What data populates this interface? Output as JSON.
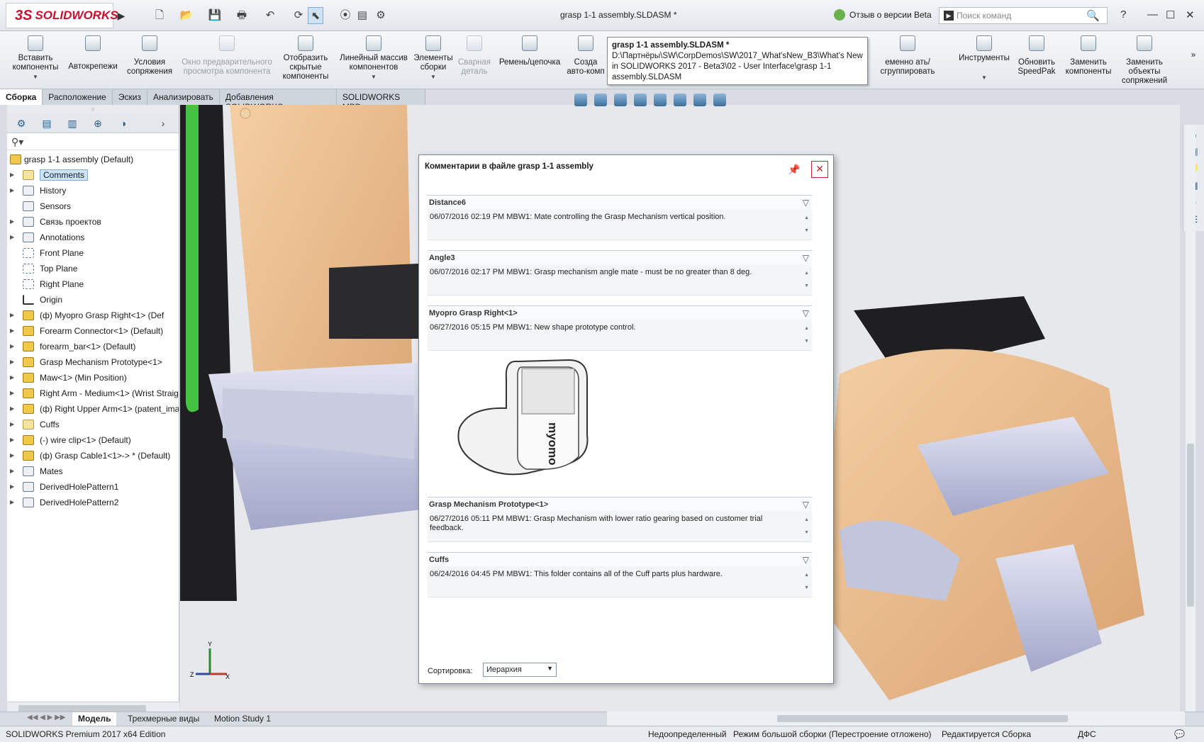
{
  "app": {
    "logo": "SOLIDWORKS",
    "window_title": "grasp 1-1 assembly.SLDASM *",
    "beta_feedback": "Отзыв о версии Beta",
    "search_placeholder": "Поиск команд",
    "help": "?"
  },
  "ribbon": {
    "buttons": [
      {
        "label": "Вставить компоненты",
        "enabled": true
      },
      {
        "label": "Автокрепежи",
        "enabled": true
      },
      {
        "label": "Условия сопряжения",
        "enabled": true
      },
      {
        "label": "Окно предварительного просмотра компонента",
        "enabled": false
      },
      {
        "label": "Отобразить скрытые компоненты",
        "enabled": true
      },
      {
        "label": "Линейный массив компонентов",
        "enabled": true
      },
      {
        "label": "Элементы сборки",
        "enabled": true
      },
      {
        "label": "Сварная деталь",
        "enabled": false
      },
      {
        "label": "Ремень/цепочка",
        "enabled": true
      },
      {
        "label": "Созда авто-комп",
        "enabled": true
      },
      {
        "label": "еменно ать/сгруппировать",
        "enabled": true
      },
      {
        "label": "Инструменты",
        "enabled": true
      },
      {
        "label": "Обновить SpeedPak",
        "enabled": true
      },
      {
        "label": "Заменить компоненты",
        "enabled": true
      },
      {
        "label": "Заменить объекты сопряжений",
        "enabled": true
      }
    ]
  },
  "tooltip": {
    "title": "grasp 1-1 assembly.SLDASM *",
    "path": "D:\\Партнёры\\SW\\CorpDemos\\SW\\2017_What'sNew_B3\\What's New in SOLIDWORKS 2017 - Beta3\\02 - User Interface\\grasp 1-1 assembly.SLDASM"
  },
  "command_tabs": [
    "Сборка",
    "Расположение",
    "Эскиз",
    "Анализировать",
    "Добавления SOLIDWORKS",
    "SOLIDWORKS MBD"
  ],
  "tree": {
    "root": "grasp 1-1 assembly  (Default)",
    "items": [
      {
        "label": "Comments",
        "selected": true,
        "icon": "folder"
      },
      {
        "label": "History",
        "icon": "history"
      },
      {
        "label": "Sensors",
        "icon": "sensor"
      },
      {
        "label": "Связь проектов",
        "icon": "link"
      },
      {
        "label": "Annotations",
        "icon": "annotation"
      },
      {
        "label": "Front Plane",
        "icon": "plane"
      },
      {
        "label": "Top Plane",
        "icon": "plane"
      },
      {
        "label": "Right Plane",
        "icon": "plane"
      },
      {
        "label": "Origin",
        "icon": "origin"
      },
      {
        "label": "(ф) Myopro Grasp Right<1> (Def",
        "icon": "assembly"
      },
      {
        "label": "Forearm Connector<1> (Default)",
        "icon": "assembly"
      },
      {
        "label": "forearm_bar<1> (Default)",
        "icon": "assembly"
      },
      {
        "label": "Grasp Mechanism Prototype<1>",
        "icon": "assembly"
      },
      {
        "label": "Maw<1> (Min Position)",
        "icon": "assembly"
      },
      {
        "label": "Right Arm - Medium<1> (Wrist Straig",
        "icon": "assembly"
      },
      {
        "label": "(ф) Right Upper Arm<1> (patent_ima",
        "icon": "assembly"
      },
      {
        "label": "Cuffs",
        "icon": "folder"
      },
      {
        "label": "(-) wire clip<1> (Default)",
        "icon": "assembly"
      },
      {
        "label": "(ф) Grasp Cable1<1>-> * (Default)",
        "icon": "assembly"
      },
      {
        "label": "Mates",
        "icon": "mates"
      },
      {
        "label": "DerivedHolePattern1",
        "icon": "pattern"
      },
      {
        "label": "DerivedHolePattern2",
        "icon": "pattern"
      }
    ]
  },
  "dialog": {
    "title": "Комментарии в файле grasp 1-1 assembly",
    "comments": [
      {
        "name": "Distance6",
        "text": "06/07/2016 02:19 PM  MBW1:  Mate controlling the Grasp Mechanism vertical position."
      },
      {
        "name": "Angle3",
        "text": "06/07/2016 02:17 PM  MBW1:  Grasp mechanism angle mate - must be no greater than 8 deg."
      },
      {
        "name": "Myopro Grasp Right<1>",
        "text": "06/27/2016 05:15 PM  MBW1:  New shape prototype control."
      },
      {
        "name": "Grasp Mechanism Prototype<1>",
        "text": "06/27/2016 05:11 PM  MBW1: Grasp Mechanism with lower ratio gearing based on customer trial feedback."
      },
      {
        "name": "Cuffs",
        "text": "06/24/2016 04:45 PM  MBW1:  This folder contains all of the Cuff parts plus hardware."
      }
    ],
    "image_brand": "myomo",
    "sort_label": "Сортировка:",
    "sort_value": "Иерархия"
  },
  "bottom_tabs": [
    "Модель",
    "Трехмерные виды",
    "Motion Study 1"
  ],
  "status": {
    "edition": "SOLIDWORKS Premium 2017 x64 Edition",
    "state1": "Недоопределенный",
    "state2": "Режим большой сборки (Перестроение отложено)",
    "state3": "Редактируется Сборка",
    "units": "ДФС"
  },
  "colors": {
    "accent": "#c8102e",
    "selection": "#cce4f7",
    "green_part": "#44c240",
    "skin": "#e8b885"
  }
}
